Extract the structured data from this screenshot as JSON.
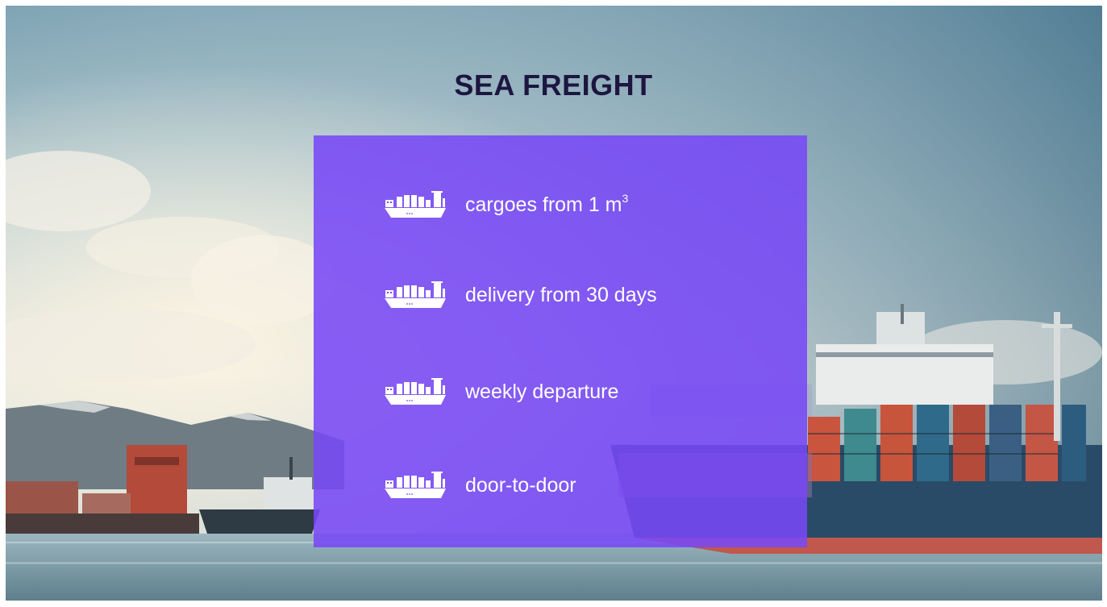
{
  "page": {
    "title": "SEA FREIGHT"
  },
  "features": [
    {
      "text": "cargoes from 1 m",
      "sup": "3",
      "icon": "cargo-ship-icon"
    },
    {
      "text": "delivery from 30 days",
      "icon": "cargo-ship-icon"
    },
    {
      "text": "weekly departure",
      "icon": "cargo-ship-icon"
    },
    {
      "text": "door-to-door",
      "icon": "cargo-ship-icon"
    }
  ],
  "colors": {
    "panel": "#7848f6",
    "title": "#1c1640",
    "text": "#ffffff"
  }
}
